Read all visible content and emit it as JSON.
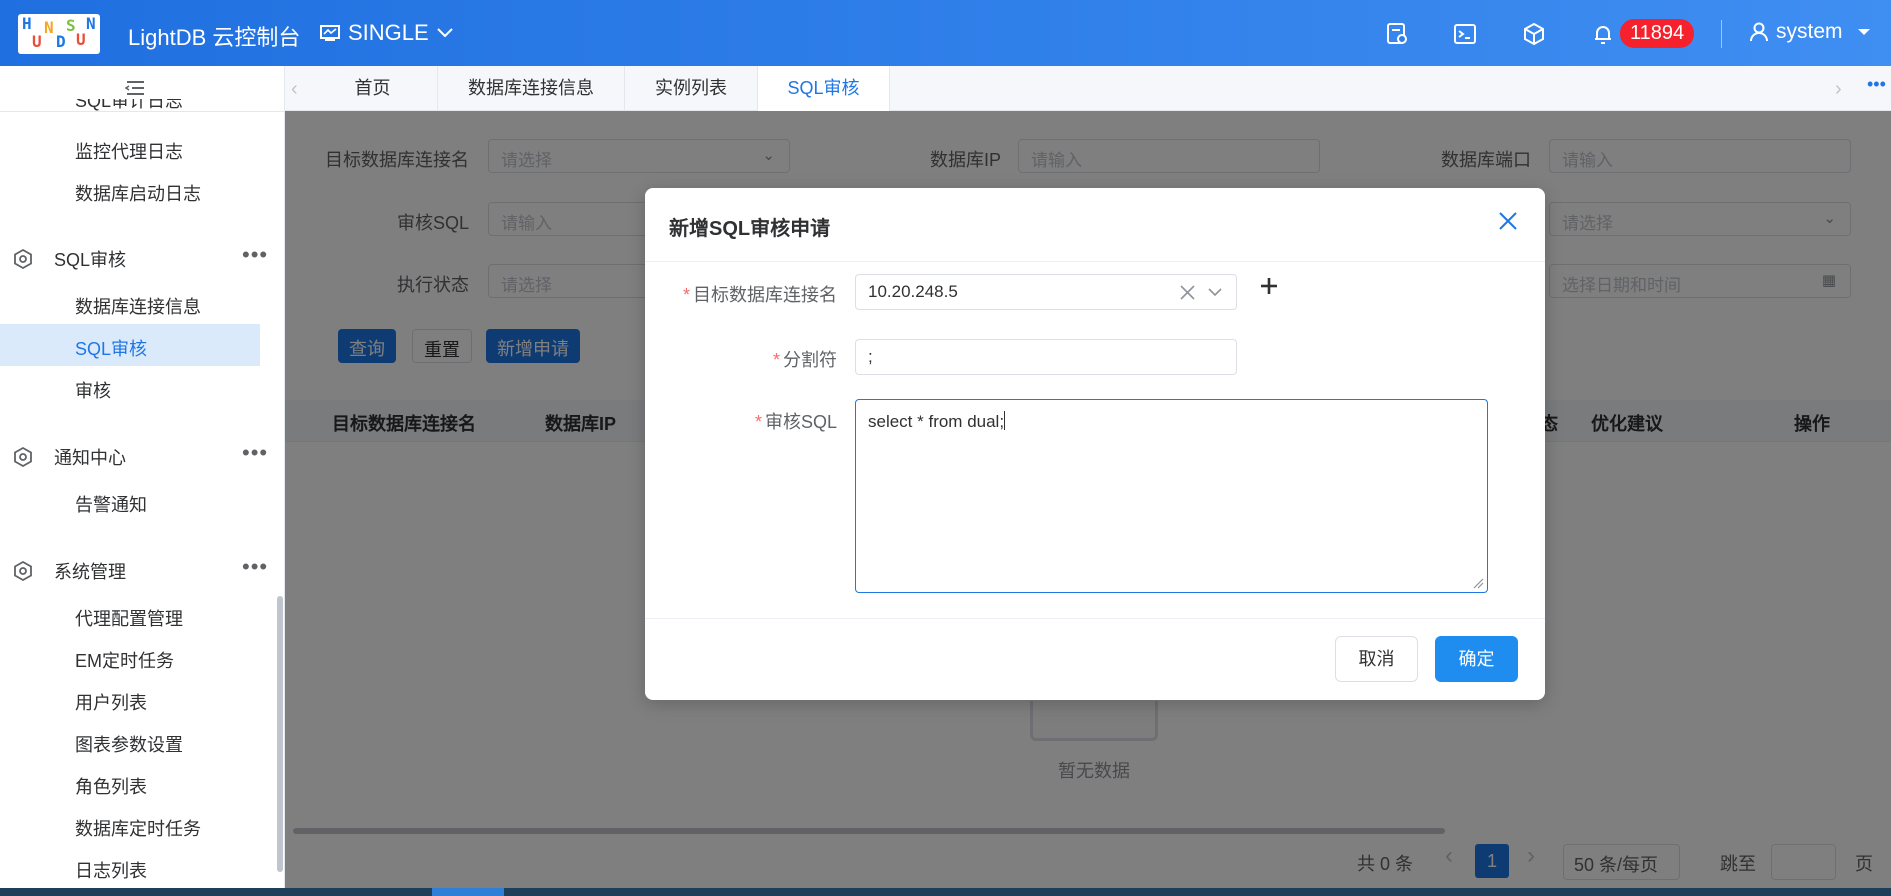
{
  "header": {
    "logo_text": "HUNDSUN",
    "app_title": "LightDB 云控制台",
    "mode": "SINGLE",
    "notification_count": "11894",
    "user": "system"
  },
  "sidebar": {
    "partial_item": "SQL审计日志",
    "items_top": [
      "监控代理日志",
      "数据库启动日志"
    ],
    "groups": [
      {
        "title": "SQL审核",
        "items": [
          "数据库连接信息",
          "SQL审核",
          "审核"
        ]
      },
      {
        "title": "通知中心",
        "items": [
          "告警通知"
        ]
      },
      {
        "title": "系统管理",
        "items": [
          "代理配置管理",
          "EM定时任务",
          "用户列表",
          "图表参数设置",
          "角色列表",
          "数据库定时任务",
          "日志列表"
        ]
      }
    ],
    "active_item": "SQL审核"
  },
  "tabs": [
    {
      "label": "首页",
      "active": false
    },
    {
      "label": "数据库连接信息",
      "active": false
    },
    {
      "label": "实例列表",
      "active": false
    },
    {
      "label": "SQL审核",
      "active": true
    }
  ],
  "filters": {
    "target_db_label": "目标数据库连接名",
    "target_db_placeholder": "请选择",
    "db_ip_label": "数据库IP",
    "db_ip_placeholder": "请输入",
    "db_port_label": "数据库端口",
    "db_port_placeholder": "请输入",
    "audit_sql_label": "审核SQL",
    "audit_sql_placeholder": "请输入",
    "select_placeholder": "请选择",
    "exec_status_label": "执行状态",
    "exec_status_placeholder": "请选择",
    "datetime_placeholder": "选择日期和时间",
    "query_button": "查询",
    "reset_button": "重置",
    "new_button": "新增申请"
  },
  "table": {
    "columns": [
      "目标数据库连接名",
      "数据库IP",
      "态",
      "优化建议",
      "操作"
    ],
    "empty_text": "暂无数据"
  },
  "pagination": {
    "total": "共 0 条",
    "current_page": "1",
    "page_size": "50 条/每页",
    "jump_label": "跳至",
    "page_unit": "页"
  },
  "dialog": {
    "title": "新增SQL审核申请",
    "target_db_label": "目标数据库连接名",
    "target_db_value": "10.20.248.5",
    "separator_label": "分割符",
    "separator_value": ";",
    "sql_label": "审核SQL",
    "sql_value": "select * from dual;",
    "cancel_button": "取消",
    "confirm_button": "确定"
  },
  "colors": {
    "primary": "#1f77e6",
    "header_start": "#1f6fe0",
    "header_end": "#3f8ef2",
    "danger": "#f5222d",
    "required": "#f56c6c"
  }
}
